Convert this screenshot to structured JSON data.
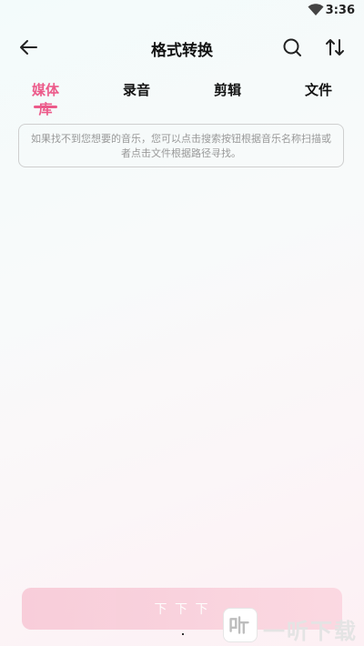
{
  "status_bar": {
    "time": "3:36",
    "wifi_icon": "wifi-icon"
  },
  "app_bar": {
    "title": "格式转换",
    "back_icon": "back-arrow-icon",
    "search_icon": "search-icon",
    "sort_icon": "sort-icon"
  },
  "tabs": [
    {
      "label": "媒体库",
      "active": true
    },
    {
      "label": "录音",
      "active": false
    },
    {
      "label": "剪辑",
      "active": false
    },
    {
      "label": "文件",
      "active": false
    }
  ],
  "hint": {
    "text": "如果找不到您想要的音乐，您可以点击搜索按钮根据音乐名称扫描或者点击文件根据路径寻找。"
  },
  "bottom_button": {
    "label": "下 下 下"
  },
  "watermark": {
    "text": "一听下载"
  },
  "colors": {
    "accent": "#ec5a8a",
    "button": "#f7c6d4"
  }
}
